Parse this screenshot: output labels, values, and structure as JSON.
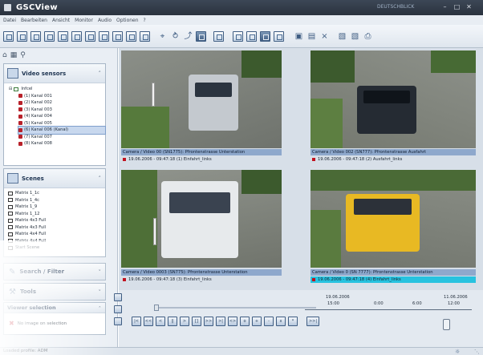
{
  "window": {
    "title": "GSCView",
    "user": "DEUTSCHBLICK",
    "minimize_icon": "minimize-icon",
    "maximize_icon": "maximize-icon",
    "close_icon": "close-icon"
  },
  "menu": [
    "Datei",
    "Bearbeiten",
    "Ansicht",
    "Monitor",
    "Audio",
    "Optionen",
    "?"
  ],
  "panels": {
    "video_sensors": {
      "title": "Video sensors",
      "tree_root": "Infcel",
      "items": [
        "(1) Kanal 001",
        "(2) Kanal 002",
        "(3) Kanal 003",
        "(4) Kanal 004",
        "(5) Kanal 005",
        "(6) Kanal 006 (Kanal)",
        "(7) Kanal 007",
        "(8) Kanal 008"
      ],
      "selected_index": 5
    },
    "scenes": {
      "title": "Scenes",
      "items": [
        "Matrix 1_1c",
        "Matrix 1_4c",
        "Matrix 1_9",
        "Matrix 1_12",
        "Matrix 4x3 Full",
        "Matrix 4x3 Full",
        "Matrix 4x4 Full",
        "Matrix 4x4 Full",
        "Start Scene"
      ]
    },
    "search_filter": {
      "title": "Search / Filter"
    },
    "tools": {
      "title": "Tools"
    },
    "viewer_selection": {
      "title": "Viewer selection",
      "item": "No image on selection"
    }
  },
  "video_tiles": [
    {
      "caption": "Camera / Video 00 (SN1775): Pfrontenstrasse Unterstation",
      "stamp": "19.06.2006 - 09:47:18   (1) Einfahrt_links"
    },
    {
      "caption": "Camera / Video 002 (SN777): Pfrontenstrasse Ausfahrt",
      "stamp": "19.06.2006 - 09:47:18   (2) Ausfahrt_links"
    },
    {
      "caption": "Camera / Video 0003 (SN775): Pfrontenstrasse Unterstation",
      "stamp": "19.06.2006 - 09:47:18   (3) Einfahrt_links"
    },
    {
      "caption": "Camera / Video 0 (SN 7777): Pfrontenstrasse Unterstation",
      "stamp": "19.06.2006 - 09:47:18   (4) Einfahrt_links"
    }
  ],
  "timeline": {
    "date_start": "19.06.2006",
    "date_end": "11.06.2006",
    "times": [
      "15:00",
      "0:00",
      "6:00",
      "12:00"
    ]
  },
  "playback_buttons": [
    "|<",
    "<<",
    "<",
    "||",
    ">",
    "[]",
    ">>",
    ">|",
    "<>",
    "o",
    "+",
    "-",
    "x",
    "*",
    ">>|"
  ],
  "status": {
    "left": "Loaded profile: ADM",
    "network_icon": "network-icon"
  }
}
